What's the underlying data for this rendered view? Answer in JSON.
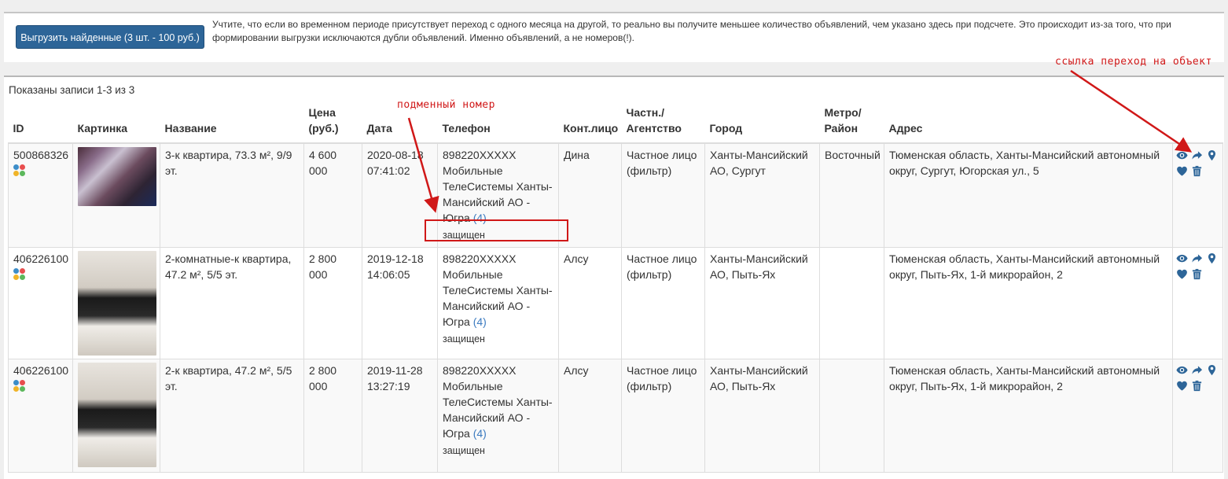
{
  "toolbar": {
    "export_label": "Выгрузить найденные (3 шт. - 100 руб.)",
    "notice_line1": "Учтите, что если во временном периоде присутствует переход с одного месяца на другой, то реально вы получите меньшее количество объявлений, чем указано здесь при подсчете. Это происходит из-за того, что при",
    "notice_line2": "формировании выгрузки исключаются дубли объявлений. Именно объявлений, а не номеров(!)."
  },
  "summary": "Показаны записи 1-3 из 3",
  "columns": {
    "id": "ID",
    "image": "Картинка",
    "name": "Название",
    "price_l1": "Цена",
    "price_l2": "(руб.)",
    "date": "Дата",
    "phone": "Телефон",
    "contact": "Конт.лицо",
    "owner_l1": "Частн./",
    "owner_l2": "Агентство",
    "city": "Город",
    "metro_l1": "Метро/",
    "metro_l2": "Район",
    "address": "Адрес"
  },
  "rows": [
    {
      "id": "500868326",
      "name": "3-к квартира, 73.3 м², 9/9 эт.",
      "price": "4 600 000",
      "date": "2020-08-18",
      "time": "07:41:02",
      "phone": "898220XXXXX",
      "operator": "Мобильные ТелеСистемы Ханты-Мансийский АО - Югра",
      "phone_count": "(4)",
      "protected": "защищен",
      "contact": "Дина",
      "owner": "Частное лицо (фильтр)",
      "city": "Ханты-Мансийский АО, Сургут",
      "metro": "Восточный",
      "address": "Тюменская область, Ханты-Мансийский автономный округ, Сургут, Югорская ул., 5"
    },
    {
      "id": "406226100",
      "name": "2-комнатные-к квартира, 47.2 м², 5/5 эт.",
      "price": "2 800 000",
      "date": "2019-12-18",
      "time": "14:06:05",
      "phone": "898220XXXXX",
      "operator": "Мобильные ТелеСистемы Ханты-Мансийский АО - Югра",
      "phone_count": "(4)",
      "protected": "защищен",
      "contact": "Алсу",
      "owner": "Частное лицо (фильтр)",
      "city": "Ханты-Мансийский АО, Пыть-Ях",
      "metro": "",
      "address": "Тюменская область, Ханты-Мансийский автономный округ, Пыть-Ях, 1-й микрорайон, 2"
    },
    {
      "id": "406226100",
      "name": "2-к квартира, 47.2 м², 5/5 эт.",
      "price": "2 800 000",
      "date": "2019-11-28",
      "time": "13:27:19",
      "phone": "898220XXXXX",
      "operator": "Мобильные ТелеСистемы Ханты-Мансийский АО - Югра",
      "phone_count": "(4)",
      "protected": "защищен",
      "contact": "Алсу",
      "owner": "Частное лицо (фильтр)",
      "city": "Ханты-Мансийский АО, Пыть-Ях",
      "metro": "",
      "address": "Тюменская область, Ханты-Мансийский автономный округ, Пыть-Ях, 1-й микрорайон, 2"
    }
  ],
  "annotations": {
    "substitute_number": "подменный номер",
    "object_link": "ссылка переход на объект"
  },
  "colors": {
    "accent": "#2d6598",
    "annotation": "#d01818",
    "link": "#3c7bc0",
    "source_dots": [
      "#3c8dc8",
      "#e84e4e",
      "#f0b429",
      "#5cb85c"
    ]
  }
}
